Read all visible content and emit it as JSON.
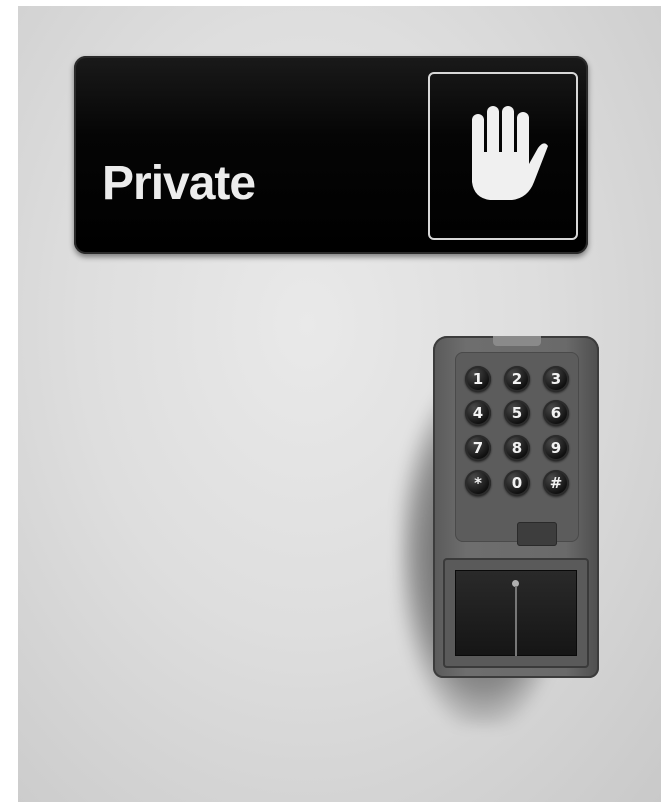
{
  "sign": {
    "label": "Private",
    "icon": "hand-stop-icon"
  },
  "keypad": {
    "keys": [
      "1",
      "2",
      "3",
      "4",
      "5",
      "6",
      "7",
      "8",
      "9",
      "*",
      "0",
      "#"
    ]
  }
}
